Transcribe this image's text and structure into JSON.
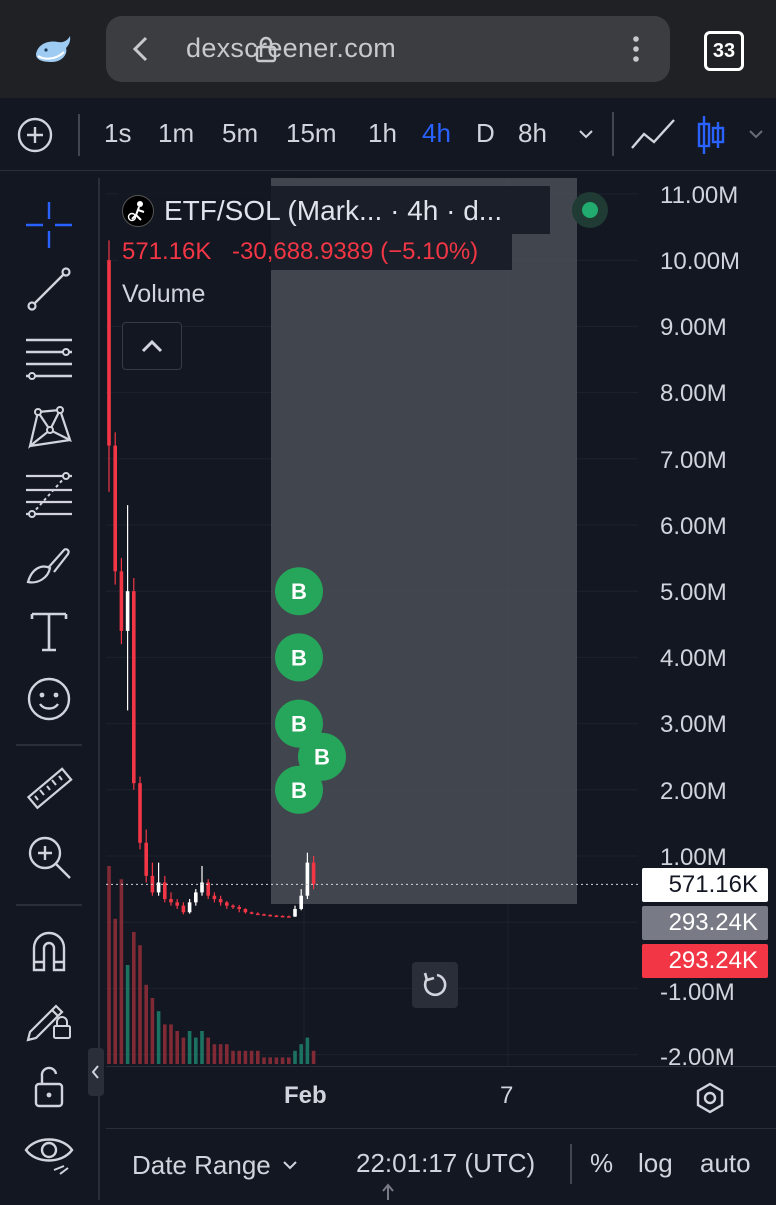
{
  "browser": {
    "url": "dexscreener.com",
    "tab_count": "33"
  },
  "timeframes": {
    "items": [
      "1s",
      "1m",
      "5m",
      "15m",
      "1h",
      "4h",
      "D",
      "8h"
    ],
    "active": "4h"
  },
  "legend": {
    "title": "ETF/SOL (Mark... · 4h · d...",
    "price": "571.16K",
    "change": "-30,688.9389 (−5.10%)",
    "volume_label": "Volume"
  },
  "price_axis": {
    "ticks": [
      "11.00M",
      "10.00M",
      "9.00M",
      "8.00M",
      "7.00M",
      "6.00M",
      "5.00M",
      "4.00M",
      "3.00M",
      "2.00M",
      "1.00M",
      "-1.00M",
      "-2.00M"
    ],
    "labels": {
      "current": "571.16K",
      "mid": "293.24K",
      "low": "293.24K"
    }
  },
  "time_axis": {
    "labels": [
      "Feb",
      "7"
    ]
  },
  "markers": {
    "buy_label": "B"
  },
  "bottom_bar": {
    "date_range": "Date Range",
    "time": "22:01:17 (UTC)",
    "percent": "%",
    "log": "log",
    "auto": "auto"
  },
  "colors": {
    "up": "#ffffff",
    "down": "#f23645",
    "buy_marker": "#26a65b",
    "accent": "#2962ff",
    "selection": "#4a4d55"
  },
  "chart_data": {
    "type": "candlestick",
    "y_unit": "market cap (USD)",
    "ylim": [
      -2200000,
      11300000
    ],
    "ohlc": [
      {
        "o": 10000000,
        "h": 10300000,
        "l": 6500000,
        "c": 7200000
      },
      {
        "o": 7200000,
        "h": 7400000,
        "l": 5100000,
        "c": 5300000
      },
      {
        "o": 5300000,
        "h": 5500000,
        "l": 4200000,
        "c": 4400000
      },
      {
        "o": 4400000,
        "h": 6300000,
        "l": 3200000,
        "c": 5000000
      },
      {
        "o": 5000000,
        "h": 5200000,
        "l": 2000000,
        "c": 2100000
      },
      {
        "o": 2100000,
        "h": 2200000,
        "l": 1100000,
        "c": 1200000
      },
      {
        "o": 1200000,
        "h": 1400000,
        "l": 600000,
        "c": 700000
      },
      {
        "o": 700000,
        "h": 900000,
        "l": 400000,
        "c": 450000
      },
      {
        "o": 450000,
        "h": 900000,
        "l": 400000,
        "c": 600000
      },
      {
        "o": 600000,
        "h": 700000,
        "l": 300000,
        "c": 350000
      },
      {
        "o": 350000,
        "h": 450000,
        "l": 250000,
        "c": 300000
      },
      {
        "o": 300000,
        "h": 350000,
        "l": 200000,
        "c": 250000
      },
      {
        "o": 250000,
        "h": 300000,
        "l": 120000,
        "c": 150000
      },
      {
        "o": 150000,
        "h": 350000,
        "l": 130000,
        "c": 300000
      },
      {
        "o": 300000,
        "h": 500000,
        "l": 250000,
        "c": 450000
      },
      {
        "o": 450000,
        "h": 850000,
        "l": 400000,
        "c": 600000
      },
      {
        "o": 600000,
        "h": 650000,
        "l": 350000,
        "c": 400000
      },
      {
        "o": 400000,
        "h": 450000,
        "l": 300000,
        "c": 350000
      },
      {
        "o": 350000,
        "h": 400000,
        "l": 250000,
        "c": 300000
      },
      {
        "o": 300000,
        "h": 320000,
        "l": 200000,
        "c": 250000
      },
      {
        "o": 250000,
        "h": 270000,
        "l": 200000,
        "c": 230000
      },
      {
        "o": 230000,
        "h": 260000,
        "l": 150000,
        "c": 200000
      },
      {
        "o": 200000,
        "h": 210000,
        "l": 130000,
        "c": 150000
      },
      {
        "o": 150000,
        "h": 160000,
        "l": 120000,
        "c": 130000
      },
      {
        "o": 130000,
        "h": 150000,
        "l": 110000,
        "c": 120000
      },
      {
        "o": 120000,
        "h": 130000,
        "l": 100000,
        "c": 110000
      },
      {
        "o": 110000,
        "h": 120000,
        "l": 90000,
        "c": 100000
      },
      {
        "o": 100000,
        "h": 110000,
        "l": 80000,
        "c": 95000
      },
      {
        "o": 95000,
        "h": 105000,
        "l": 80000,
        "c": 90000
      },
      {
        "o": 90000,
        "h": 100000,
        "l": 75000,
        "c": 85000
      },
      {
        "o": 85000,
        "h": 250000,
        "l": 80000,
        "c": 200000
      },
      {
        "o": 200000,
        "h": 500000,
        "l": 180000,
        "c": 400000
      },
      {
        "o": 400000,
        "h": 1050000,
        "l": 350000,
        "c": 900000
      },
      {
        "o": 900000,
        "h": 1000000,
        "l": 500000,
        "c": 571160
      }
    ],
    "volume": [
      30,
      22,
      28,
      15,
      20,
      18,
      12,
      10,
      8,
      6,
      6,
      5,
      4,
      5,
      4,
      5,
      4,
      3,
      3,
      3,
      2,
      2,
      2,
      2,
      2,
      1,
      1,
      1,
      1,
      1,
      2,
      3,
      4,
      2
    ],
    "buy_markers": [
      5000000,
      4000000,
      3000000,
      2500000,
      2000000
    ],
    "current_price": 571160
  }
}
